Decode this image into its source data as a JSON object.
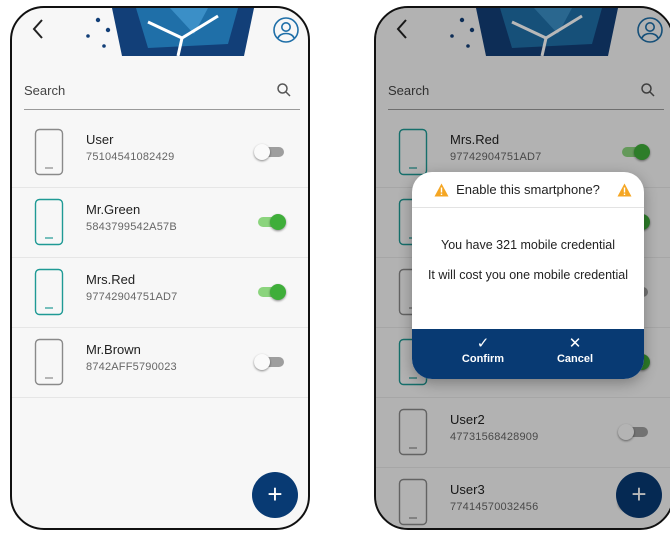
{
  "left_screen": {
    "search": {
      "placeholder": "Search"
    },
    "devices": [
      {
        "name": "User",
        "serial": "75104541082429",
        "enabled": false,
        "highlight": false
      },
      {
        "name": "Mr.Green",
        "serial": "5843799542A57B",
        "enabled": true,
        "highlight": true
      },
      {
        "name": "Mrs.Red",
        "serial": "97742904751AD7",
        "enabled": true,
        "highlight": true
      },
      {
        "name": "Mr.Brown",
        "serial": "8742AFF5790023",
        "enabled": false,
        "highlight": false
      }
    ],
    "fab_label": "+"
  },
  "right_screen": {
    "search": {
      "placeholder": "Search"
    },
    "devices": [
      {
        "name": "Mrs.Red",
        "serial": "97742904751AD7",
        "enabled": true,
        "highlight": true
      },
      {
        "name": "",
        "serial": "",
        "enabled": true,
        "highlight": true
      },
      {
        "name": "",
        "serial": "",
        "enabled": false,
        "highlight": false
      },
      {
        "name": "",
        "serial": "",
        "enabled": true,
        "highlight": true
      },
      {
        "name": "User2",
        "serial": "47731568428909",
        "enabled": false,
        "highlight": false
      },
      {
        "name": "User3",
        "serial": "77414570032456",
        "enabled": false,
        "highlight": false
      }
    ],
    "fab_label": "+",
    "dialog": {
      "title": "Enable this smartphone?",
      "line1": "You have 321 mobile credential",
      "line2": "It will cost you one mobile credential",
      "confirm_label": "Confirm",
      "confirm_icon": "✓",
      "cancel_label": "Cancel",
      "cancel_icon": "✕"
    }
  },
  "colors": {
    "brand_navy": "#083a73",
    "toggle_on": "#3fae3a",
    "toggle_on_track": "#8bd47d",
    "device_highlight": "#1f9a95",
    "device_default": "#8a8a8a",
    "warning": "#f5a623"
  },
  "icons": {
    "back": "chevron-left-icon",
    "account": "account-circle-icon",
    "search": "search-icon",
    "warning": "warning-icon",
    "confirm": "check-icon",
    "cancel": "close-icon",
    "add": "plus-icon"
  }
}
